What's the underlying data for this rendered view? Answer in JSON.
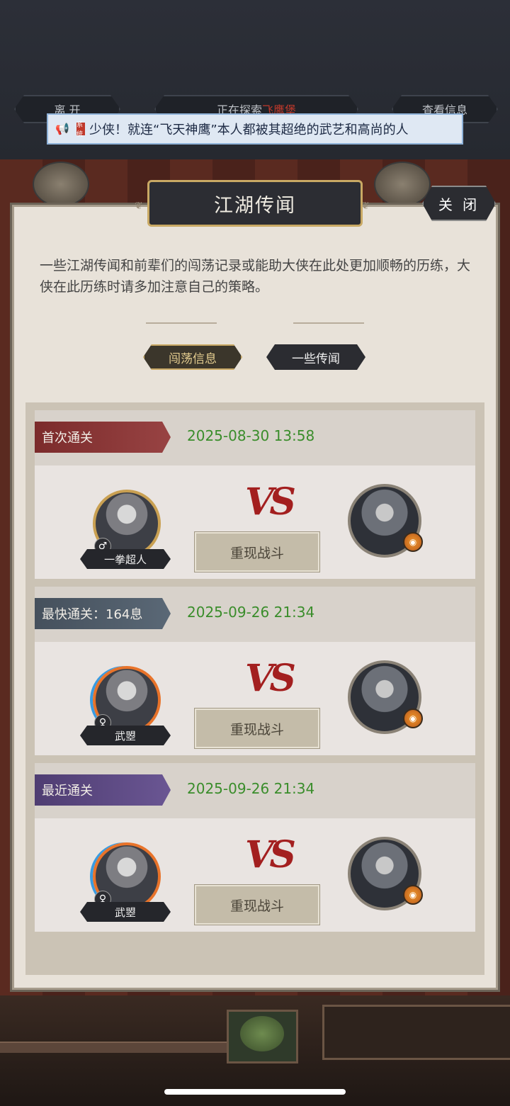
{
  "top_nav": {
    "leave": "离 开",
    "exploring_prefix": "正在探索",
    "exploring_place": "飞鹰堡",
    "view_info": "查看信息"
  },
  "announcement": {
    "icon": "megaphone-icon",
    "badge": "系统",
    "text": "少侠！就连“飞天神鹰”本人都被其超绝的武艺和高尚的人"
  },
  "dialog": {
    "title": "江湖传闻",
    "close_label": "关 闭",
    "description": "一些江湖传闻和前辈们的闯荡记录或能助大侠在此处更加顺畅的历练，大侠在此历练时请多加注意自己的策略。",
    "tabs": [
      {
        "label": "闯荡信息",
        "active": true
      },
      {
        "label": "一些传闻",
        "active": false
      }
    ]
  },
  "records": [
    {
      "tag": "首次通关",
      "time": "2025-08-30 13:58",
      "player": "一拳超人",
      "gender": "♂",
      "vs": "VS",
      "replay": "重现战斗"
    },
    {
      "tag": "最快通关：164息",
      "time": "2025-09-26 21:34",
      "player": "武曌",
      "gender": "♀",
      "vs": "VS",
      "replay": "重现战斗"
    },
    {
      "tag": "最近通关",
      "time": "2025-09-26 21:34",
      "player": "武曌",
      "gender": "♀",
      "vs": "VS",
      "replay": "重现战斗"
    }
  ],
  "colors": {
    "accent_gold": "#c9a964",
    "time_green": "#3a8d2b",
    "ribbon_first": "#7b2b2b",
    "ribbon_fastest": "#45505c",
    "ribbon_recent": "#4f3d72"
  }
}
